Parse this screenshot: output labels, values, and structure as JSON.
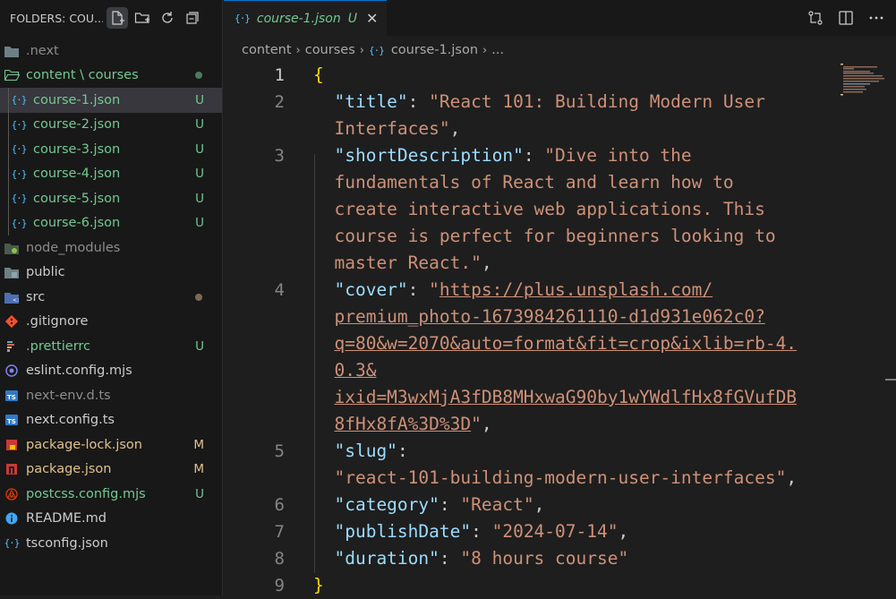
{
  "sidebar": {
    "title": "FOLDERS: COU...",
    "tree": [
      {
        "label": ".next",
        "status": "",
        "color": "grey",
        "icon": "folder-icon"
      },
      {
        "label": "content \\ courses",
        "status": "dot",
        "color": "green",
        "icon": "folder-open-icon"
      },
      {
        "label": "course-1.json",
        "status": "U",
        "color": "green",
        "icon": "json-icon",
        "child": true,
        "selected": true
      },
      {
        "label": "course-2.json",
        "status": "U",
        "color": "green",
        "icon": "json-icon",
        "child": true
      },
      {
        "label": "course-3.json",
        "status": "U",
        "color": "green",
        "icon": "json-icon",
        "child": true
      },
      {
        "label": "course-4.json",
        "status": "U",
        "color": "green",
        "icon": "json-icon",
        "child": true
      },
      {
        "label": "course-5.json",
        "status": "U",
        "color": "green",
        "icon": "json-icon",
        "child": true
      },
      {
        "label": "course-6.json",
        "status": "U",
        "color": "green",
        "icon": "json-icon",
        "child": true
      },
      {
        "label": "node_modules",
        "status": "",
        "color": "grey",
        "icon": "node-folder-icon"
      },
      {
        "label": "public",
        "status": "",
        "color": "normal",
        "icon": "public-folder-icon"
      },
      {
        "label": "src",
        "status": "dot-brown",
        "color": "normal",
        "icon": "src-folder-icon"
      },
      {
        "label": ".gitignore",
        "status": "",
        "color": "normal",
        "icon": "git-icon"
      },
      {
        "label": ".prettierrc",
        "status": "U",
        "color": "green",
        "icon": "prettier-icon"
      },
      {
        "label": "eslint.config.mjs",
        "status": "",
        "color": "normal",
        "icon": "eslint-icon"
      },
      {
        "label": "next-env.d.ts",
        "status": "",
        "color": "grey",
        "icon": "ts-icon"
      },
      {
        "label": "next.config.ts",
        "status": "",
        "color": "normal",
        "icon": "ts-icon"
      },
      {
        "label": "package-lock.json",
        "status": "M",
        "color": "yellow",
        "icon": "package-lock-icon"
      },
      {
        "label": "package.json",
        "status": "M",
        "color": "yellow",
        "icon": "npm-icon"
      },
      {
        "label": "postcss.config.mjs",
        "status": "U",
        "color": "green",
        "icon": "postcss-icon"
      },
      {
        "label": "README.md",
        "status": "",
        "color": "normal",
        "icon": "info-icon"
      },
      {
        "label": "tsconfig.json",
        "status": "",
        "color": "normal",
        "icon": "json-icon"
      }
    ]
  },
  "tab": {
    "label": "course-1.json",
    "badge": "U"
  },
  "breadcrumb": [
    "content",
    "courses",
    "course-1.json",
    "..."
  ],
  "code": {
    "line_numbers": [
      "1",
      "2",
      "3",
      "4",
      "5",
      "6",
      "7",
      "8",
      "9"
    ],
    "lines": [
      [
        {
          "t": "{",
          "c": "brace"
        }
      ],
      [
        {
          "t": "  ",
          "c": "p"
        },
        {
          "t": "\"title\"",
          "c": "key"
        },
        {
          "t": ": ",
          "c": "p"
        },
        {
          "t": "\"React 101: Building Modern User",
          "c": "str"
        }
      ],
      [
        {
          "t": "  ",
          "c": "p"
        },
        {
          "t": "Interfaces\"",
          "c": "str"
        },
        {
          "t": ",",
          "c": "p"
        }
      ],
      [
        {
          "t": "  ",
          "c": "p"
        },
        {
          "t": "\"shortDescription\"",
          "c": "key"
        },
        {
          "t": ": ",
          "c": "p"
        },
        {
          "t": "\"Dive into the",
          "c": "str"
        }
      ],
      [
        {
          "t": "  ",
          "c": "p"
        },
        {
          "t": "fundamentals of React and learn how to",
          "c": "str"
        }
      ],
      [
        {
          "t": "  ",
          "c": "p"
        },
        {
          "t": "create interactive web applications. This",
          "c": "str"
        }
      ],
      [
        {
          "t": "  ",
          "c": "p"
        },
        {
          "t": "course is perfect for beginners looking to",
          "c": "str"
        }
      ],
      [
        {
          "t": "  ",
          "c": "p"
        },
        {
          "t": "master React.\"",
          "c": "str"
        },
        {
          "t": ",",
          "c": "p"
        }
      ],
      [
        {
          "t": "  ",
          "c": "p"
        },
        {
          "t": "\"cover\"",
          "c": "key"
        },
        {
          "t": ": ",
          "c": "p"
        },
        {
          "t": "\"",
          "c": "str"
        },
        {
          "t": "https://plus.unsplash.com/",
          "c": "url"
        }
      ],
      [
        {
          "t": "  ",
          "c": "p"
        },
        {
          "t": "premium_photo-1673984261110-d1d931e062c0?",
          "c": "url"
        }
      ],
      [
        {
          "t": "  ",
          "c": "p"
        },
        {
          "t": "q=80&w=2070&auto=format&fit=crop&ixlib=rb-4.",
          "c": "url"
        }
      ],
      [
        {
          "t": "  ",
          "c": "p"
        },
        {
          "t": "0.3&",
          "c": "url"
        }
      ],
      [
        {
          "t": "  ",
          "c": "p"
        },
        {
          "t": "ixid=M3wxMjA3fDB8MHxwaG90by1wYWdlfHx8fGVufDB",
          "c": "url"
        }
      ],
      [
        {
          "t": "  ",
          "c": "p"
        },
        {
          "t": "8fHx8fA%3D%3D",
          "c": "url"
        },
        {
          "t": "\"",
          "c": "str"
        },
        {
          "t": ",",
          "c": "p"
        }
      ],
      [
        {
          "t": "  ",
          "c": "p"
        },
        {
          "t": "\"slug\"",
          "c": "key"
        },
        {
          "t": ":",
          "c": "p"
        }
      ],
      [
        {
          "t": "  ",
          "c": "p"
        },
        {
          "t": "\"react-101-building-modern-user-interfaces\"",
          "c": "str"
        },
        {
          "t": ",",
          "c": "p"
        }
      ],
      [
        {
          "t": "  ",
          "c": "p"
        },
        {
          "t": "\"category\"",
          "c": "key"
        },
        {
          "t": ": ",
          "c": "p"
        },
        {
          "t": "\"React\"",
          "c": "str"
        },
        {
          "t": ",",
          "c": "p"
        }
      ],
      [
        {
          "t": "  ",
          "c": "p"
        },
        {
          "t": "\"publishDate\"",
          "c": "key"
        },
        {
          "t": ": ",
          "c": "p"
        },
        {
          "t": "\"2024-07-14\"",
          "c": "str"
        },
        {
          "t": ",",
          "c": "p"
        }
      ],
      [
        {
          "t": "  ",
          "c": "p"
        },
        {
          "t": "\"duration\"",
          "c": "key"
        },
        {
          "t": ": ",
          "c": "p"
        },
        {
          "t": "\"8 hours course\"",
          "c": "str"
        }
      ],
      [
        {
          "t": "}",
          "c": "brace"
        }
      ]
    ],
    "line_number_rows": [
      0,
      1,
      3,
      8,
      14,
      16,
      17,
      18,
      19
    ]
  }
}
